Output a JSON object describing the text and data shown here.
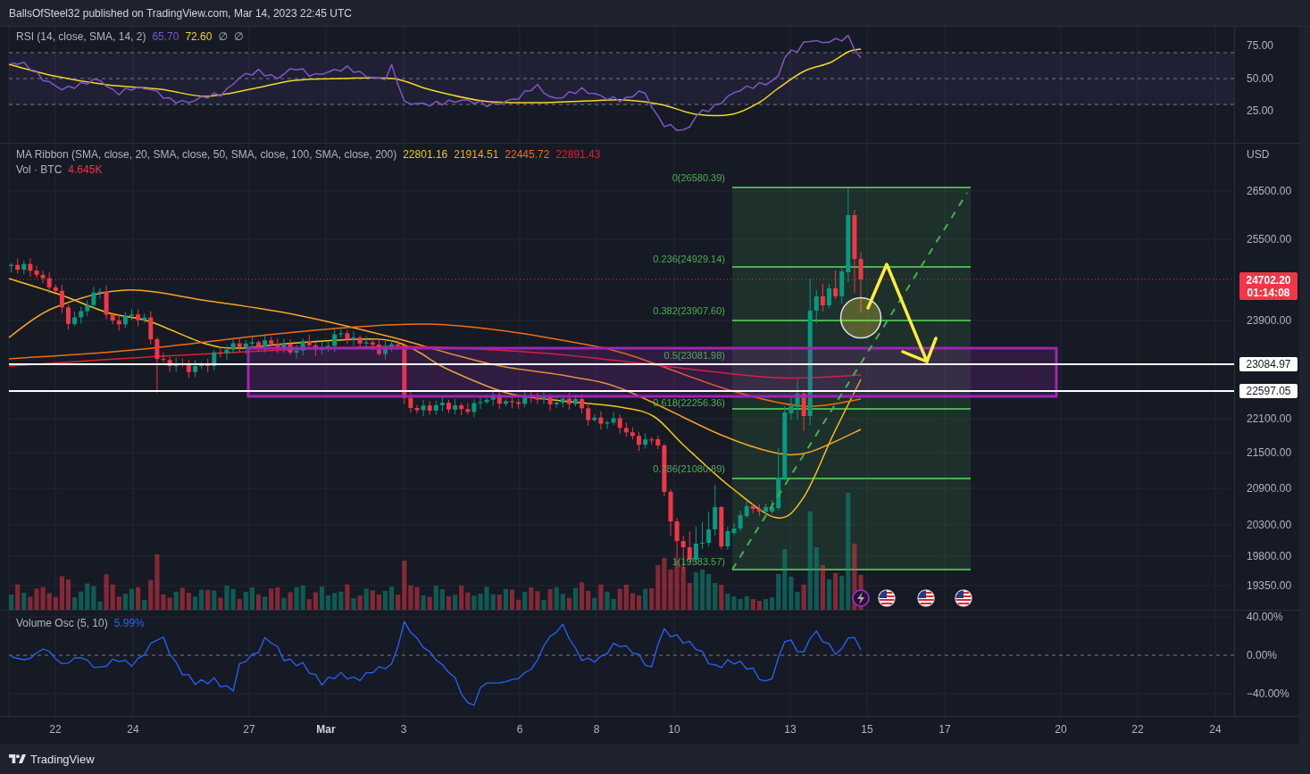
{
  "header": {
    "attribution": "BallsOfSteel32 published on TradingView.com, Mar 14, 2023 22:45 UTC"
  },
  "rsi_pane": {
    "legend": {
      "title": "RSI (14, close, SMA, 14, 2)",
      "values": [
        {
          "value": "65.70",
          "color": "#7e57c2"
        },
        {
          "value": "72.60",
          "color": "#f2d52b"
        },
        {
          "value": "∅"
        },
        {
          "value": "∅"
        }
      ]
    },
    "axis_labels": [
      "75.00",
      "50.00",
      "25.00"
    ]
  },
  "main_pane": {
    "legends": [
      {
        "title": "MA Ribbon (SMA, close, 20, SMA, close, 50, SMA, close, 100, SMA, close, 200)",
        "values": [
          {
            "value": "22801.16",
            "color": "#f5c518"
          },
          {
            "value": "21914.51",
            "color": "#f5a623"
          },
          {
            "value": "22445.72",
            "color": "#f26d0f"
          },
          {
            "value": "22891.43",
            "color": "#e0202a"
          }
        ]
      },
      {
        "title": "Vol · BTC",
        "values": [
          {
            "value": "4.645K",
            "color": "#f23645"
          }
        ]
      }
    ],
    "currency": "USD",
    "axis_labels": [
      "26500.00",
      "25500.00",
      "23900.00",
      "22100.00",
      "21500.00",
      "20900.00",
      "20300.00",
      "19800.00",
      "19350.00"
    ],
    "last_price": {
      "price": "24702.20",
      "countdown": "01:14:08"
    },
    "price_lines": [
      "23084.97",
      "22597.05"
    ],
    "fib_levels": [
      "0(26580.39)",
      "0.236(24929.14)",
      "0.382(23907.60)",
      "0.5(23081.98)",
      "0.618(22256.36)",
      "0.786(21080.89)",
      "1(19583.57)"
    ]
  },
  "volume_osc_pane": {
    "legend": {
      "title": "Volume Osc (5, 10)",
      "values": [
        {
          "value": "5.99%",
          "color": "#2962ff"
        }
      ]
    },
    "axis_labels": [
      "40.00%",
      "0.00%",
      "−40.00%"
    ]
  },
  "time_axis": [
    {
      "label": "22",
      "kind": "day"
    },
    {
      "label": "24",
      "kind": "day"
    },
    {
      "label": "27",
      "kind": "day"
    },
    {
      "label": "Mar",
      "kind": "month"
    },
    {
      "label": "3",
      "kind": "day"
    },
    {
      "label": "6",
      "kind": "day"
    },
    {
      "label": "8",
      "kind": "day"
    },
    {
      "label": "10",
      "kind": "day"
    },
    {
      "label": "13",
      "kind": "day"
    },
    {
      "label": "15",
      "kind": "day"
    },
    {
      "label": "17",
      "kind": "day"
    },
    {
      "label": "20",
      "kind": "day"
    },
    {
      "label": "22",
      "kind": "day"
    },
    {
      "label": "24",
      "kind": "day"
    }
  ],
  "footer": {
    "logo_text": "TradingView"
  }
}
